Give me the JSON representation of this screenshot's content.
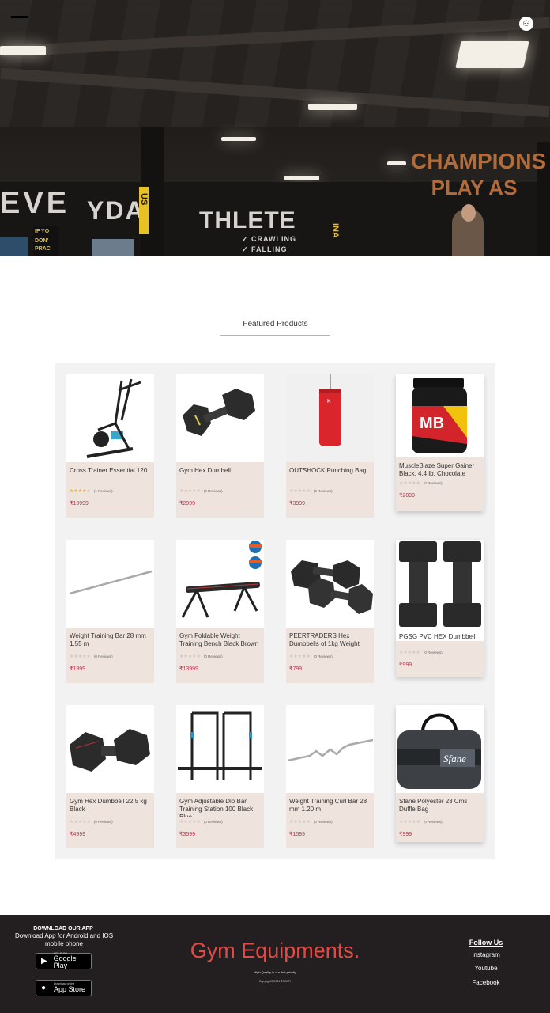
{
  "hero": {
    "wall_text_left": "EVE",
    "wall_text_mid": "YDA",
    "wall_text_right": "THLETE",
    "wall_list_1": "✓ CRAWLING",
    "wall_list_2": "✓ FALLING",
    "poster_text_1": "IF YO",
    "poster_text_2": "DON'",
    "poster_text_3": "PRAC",
    "orange_line_1": "CHAMPIONS",
    "orange_line_2": "PLAY AS",
    "pillar_text": "US",
    "pillar_text_2": "INA"
  },
  "featured": {
    "title": "Featured Products"
  },
  "products": [
    {
      "name": "Cross Trainer Essential 120",
      "reviews": "(1 Reviews)",
      "price": "₹19999",
      "stars": 4
    },
    {
      "name": "Gym Hex Dumbell",
      "reviews": "(0 Reviews)",
      "price": "₹2999",
      "stars": 0
    },
    {
      "name": "OUTSHOCK Punching Bag",
      "reviews": "(0 Reviews)",
      "price": "₹3999",
      "stars": 0
    },
    {
      "name": "MuscleBlaze Super Gainer Black, 4.4 lb, Chocolate",
      "reviews": "(0 Reviews)",
      "price": "₹2099",
      "stars": 0
    },
    {
      "name": "Weight Training Bar 28 mm 1.55 m",
      "reviews": "(0 Reviews)",
      "price": "₹1999",
      "stars": 0
    },
    {
      "name": "Gym Foldable Weight Training Bench Black Brown",
      "reviews": "(0 Reviews)",
      "price": "₹13999",
      "stars": 0
    },
    {
      "name": "PEERTRADERS Hex Dumbbells of 1kg Weight",
      "reviews": "(0 Reviews)",
      "price": "₹799",
      "stars": 0
    },
    {
      "name": "PGSG PVC HEX Dumbbell",
      "reviews": "(0 Reviews)",
      "price": "₹999",
      "stars": 0
    },
    {
      "name": "Gym Hex Dumbbell 22.5 kg Black",
      "reviews": "(0 Reviews)",
      "price": "₹4999",
      "stars": 0
    },
    {
      "name": "Gym Adjustable Dip Bar Training Station 100 Black Blue",
      "reviews": "(0 Reviews)",
      "price": "₹3599",
      "stars": 0
    },
    {
      "name": "Weight Training Curl Bar 28 mm 1.20 m",
      "reviews": "(0 Reviews)",
      "price": "₹1599",
      "stars": 0
    },
    {
      "name": "Sfane Polyester 23 Cms Duffle Bag",
      "reviews": "(0 Reviews)",
      "price": "₹999",
      "stars": 0
    }
  ],
  "product_image_text": {
    "gainer_brand": "MB",
    "bag_brand": "Sfane"
  },
  "footer": {
    "download_title": "DOWNLOAD OUR APP",
    "download_text": "Download App for Android and IOS mobile phone",
    "google_small": "GET IT ON",
    "google_big": "Google Play",
    "apple_small": "Download on the",
    "apple_big": "App Store",
    "brand": "Gym Equipments.",
    "tagline": "High Quality is our first priority",
    "copyright": "Copyright© 2021 ©SEAPI",
    "follow": "Follow Us",
    "social": [
      "Instagram",
      "Youtube",
      "Facebook"
    ]
  },
  "colors": {
    "accent": "#e34a45",
    "price": "#c0314e",
    "card_bg": "#efe3dd",
    "footer_bg": "#231f20"
  }
}
